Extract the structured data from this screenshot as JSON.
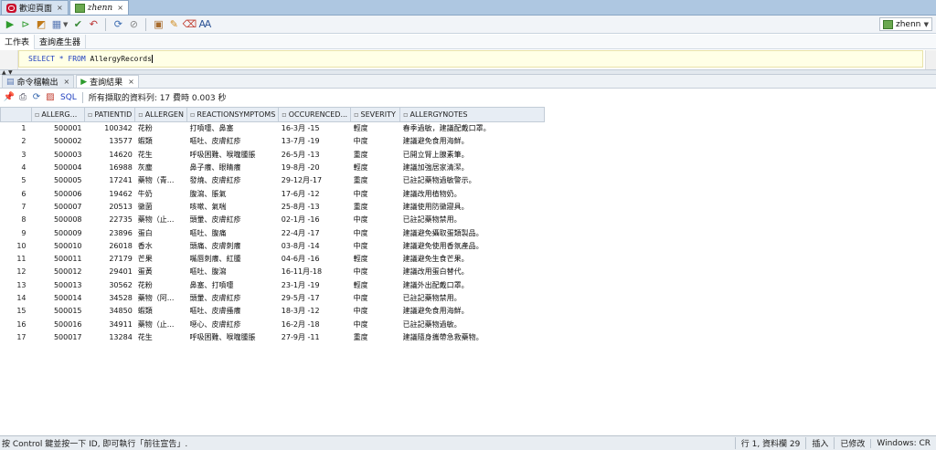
{
  "doc_tabs": [
    {
      "label": "歡迎頁面",
      "icon": "oracle-icon"
    },
    {
      "label": "zhenn",
      "icon": "connection-icon"
    }
  ],
  "toolbar": {
    "connection": "zhenn"
  },
  "subtabs": [
    "工作表",
    "查詢產生器"
  ],
  "editor": {
    "select_kw": "SELECT",
    "star": "*",
    "from_kw": "FROM",
    "table": "AllergyRecords"
  },
  "result_tabs": [
    {
      "label": "命令檔輸出",
      "icon": "script-output-icon"
    },
    {
      "label": "查詢結果",
      "icon": "run-icon"
    }
  ],
  "result_toolbar": {
    "sql_label": "SQL",
    "fetch_status": "所有擷取的資料列: 17 費時 0.003 秒"
  },
  "grid": {
    "columns": [
      "ALLERG...",
      "PATIENTID",
      "ALLERGEN",
      "REACTIONSYMPTOMS",
      "OCCURENCED...",
      "SEVERITY",
      "ALLERGYNOTES"
    ],
    "rows": [
      [
        "1",
        "500001",
        "100342",
        "花粉",
        "打噴嚏、鼻塞",
        "16-3月 -15",
        "輕度",
        "春季過敏，建議配戴口罩。"
      ],
      [
        "2",
        "500002",
        "13577",
        "蝦類",
        "嘔吐、皮膚紅疹",
        "13-7月 -19",
        "中度",
        "建議避免食用海鮮。"
      ],
      [
        "3",
        "500003",
        "14620",
        "花生",
        "呼吸困難、喉嚨腫脹",
        "26-5月 -13",
        "重度",
        "已開立腎上腺素筆。"
      ],
      [
        "4",
        "500004",
        "16988",
        "灰塵",
        "鼻子癢、眼睛癢",
        "19-8月 -20",
        "輕度",
        "建議加強居家清潔。"
      ],
      [
        "5",
        "500005",
        "17241",
        "藥物（青...",
        "發燒、皮膚紅疹",
        "29-12月-17",
        "重度",
        "已註記藥物過敏警示。"
      ],
      [
        "6",
        "500006",
        "19462",
        "牛奶",
        "腹瀉、脹氣",
        "17-6月 -12",
        "中度",
        "建議改用植物奶。"
      ],
      [
        "7",
        "500007",
        "20513",
        "黴菌",
        "咳嗽、氣喘",
        "25-8月 -13",
        "重度",
        "建議使用防黴寢具。"
      ],
      [
        "8",
        "500008",
        "22735",
        "藥物（止...",
        "頭暈、皮膚紅疹",
        "02-1月 -16",
        "中度",
        "已註記藥物禁用。"
      ],
      [
        "9",
        "500009",
        "23896",
        "蛋白",
        "嘔吐、腹痛",
        "22-4月 -17",
        "中度",
        "建議避免攝取蛋類製品。"
      ],
      [
        "10",
        "500010",
        "26018",
        "香水",
        "頭痛、皮膚刺癢",
        "03-8月 -14",
        "中度",
        "建議避免使用香氛產品。"
      ],
      [
        "11",
        "500011",
        "27179",
        "芒果",
        "嘴唇刺癢、紅腫",
        "04-6月 -16",
        "輕度",
        "建議避免生食芒果。"
      ],
      [
        "12",
        "500012",
        "29401",
        "蛋黃",
        "嘔吐、腹瀉",
        "16-11月-18",
        "中度",
        "建議改用蛋白替代。"
      ],
      [
        "13",
        "500013",
        "30562",
        "花粉",
        "鼻塞、打噴嚏",
        "23-1月 -19",
        "輕度",
        "建議外出配戴口罩。"
      ],
      [
        "14",
        "500014",
        "34528",
        "藥物（阿...",
        "頭暈、皮膚紅疹",
        "29-5月 -17",
        "中度",
        "已註記藥物禁用。"
      ],
      [
        "15",
        "500015",
        "34850",
        "蝦類",
        "嘔吐、皮膚搔癢",
        "18-3月 -12",
        "中度",
        "建議避免食用海鮮。"
      ],
      [
        "16",
        "500016",
        "34911",
        "藥物（止...",
        "噁心、皮膚紅疹",
        "16-2月 -18",
        "中度",
        "已註記藥物過敏。"
      ],
      [
        "17",
        "500017",
        "13284",
        "花生",
        "呼吸困難、喉嚨腫脹",
        "27-9月 -11",
        "重度",
        "建議隨身攜帶急救藥物。"
      ]
    ]
  },
  "status_bar": {
    "hint": "按 Control 鍵並按一下 ID, 即可執行「前往宣告」.",
    "position": "行 1, 資料欄 29",
    "insert_mode": "插入",
    "modified": "已修改",
    "line_ending": "Windows: CR"
  },
  "colors": {
    "tab_strip": "#aec7e1",
    "keyword": "#1f3fbf",
    "editor_line": "#ffffe6",
    "run_green": "#2e9b2e"
  }
}
